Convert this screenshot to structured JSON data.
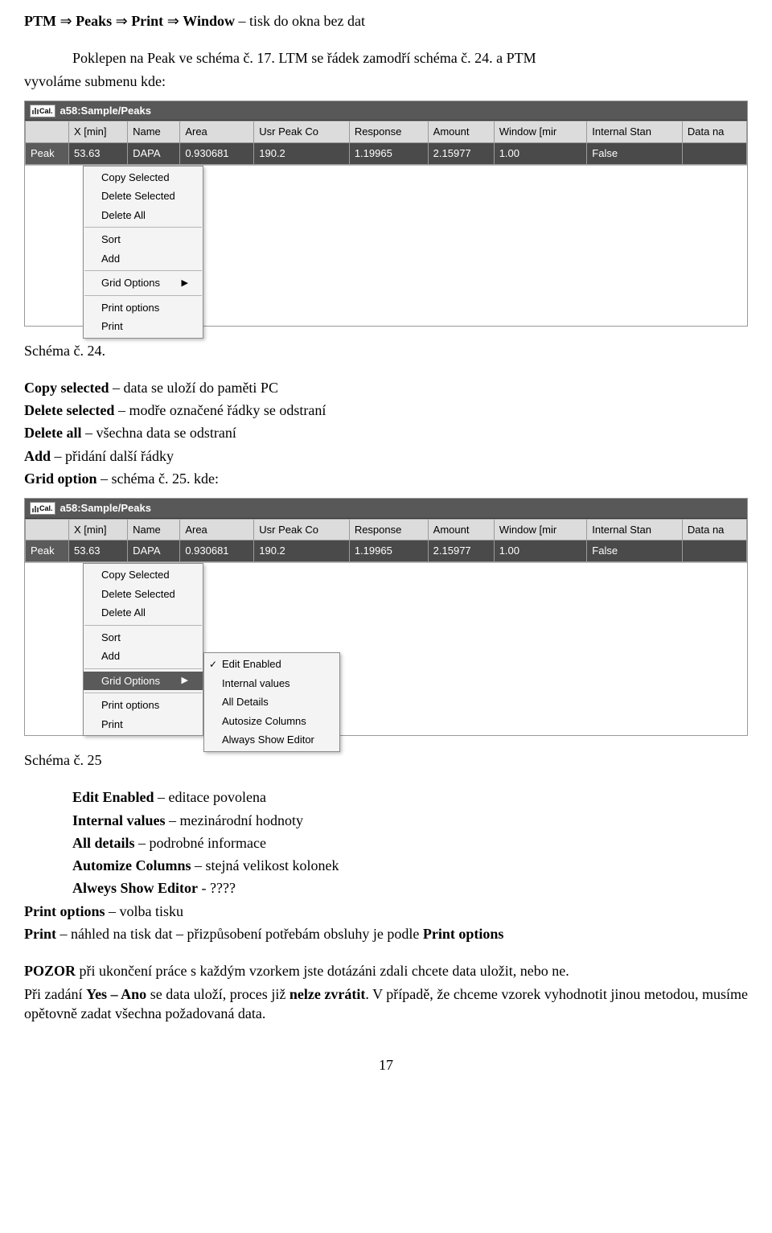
{
  "line1": {
    "b1": "PTM",
    "a1": "⇒",
    "b2": "Peaks",
    "a2": "⇒",
    "b3": "Print",
    "a3": "⇒",
    "b4": "Window",
    "tail": " – tisk do okna bez dat"
  },
  "line2_indent": "Poklepen na Peak ve schéma č. 17. LTM se řádek zamodří schéma č. 24. a PTM",
  "line2b": "vyvoláme submenu kde:",
  "caption1": "Schéma č. 24.",
  "def_block": [
    {
      "b": "Copy selected",
      "t": " – data se uloží do paměti PC"
    },
    {
      "b": "Delete selected",
      "t": " – modře označené řádky se odstraní"
    },
    {
      "b": "Delete all",
      "t": " – všechna data se odstraní"
    },
    {
      "b": "Add",
      "t": " – přidání další řádky"
    },
    {
      "b": "Grid option",
      "t": " – schéma č. 25. kde:"
    }
  ],
  "caption2": "Schéma č. 25",
  "def_block2": [
    {
      "b": "Edit Enabled",
      "t": " – editace povolena"
    },
    {
      "b": "Internal values",
      "t": " – mezinárodní hodnoty"
    },
    {
      "b": "All details",
      "t": " – podrobné informace"
    },
    {
      "b": "Automize Columns",
      "t": " – stejná velikost kolonek"
    },
    {
      "b": "Alweys Show Editor",
      "t": " - ????"
    }
  ],
  "line_po": {
    "b": "Print options",
    "t": " – volba tisku"
  },
  "line_print": {
    "b1": "Print",
    "t1": " – náhled na tisk dat – přizpůsobení potřebám obsluhy je podle ",
    "b2": "Print options"
  },
  "warn": {
    "b": "POZOR",
    "t": " při ukončení práce s každým vzorkem jste dotázáni zdali chcete data uložit, nebo ne."
  },
  "warn2a": "Při zadání ",
  "warn2b": "Yes – Ano",
  "warn2c": " se data uloží, proces již ",
  "warn2d": "nelze zvrátit",
  "warn2e": ". V případě, že chceme vzorek vyhodnotit jinou metodou, musíme opětovně zadat všechna požadovaná data.",
  "pagenum": "17",
  "shot": {
    "cal": "Cal.",
    "title": "a58:Sample/Peaks",
    "headers": [
      "",
      "X [min]",
      "Name",
      "Area",
      "Usr Peak Co",
      "Response",
      "Amount",
      "Window [mir",
      "Internal Stan",
      "Data na"
    ],
    "row": [
      "Peak",
      "53.63",
      "DAPA",
      "0.930681",
      "190.2",
      "1.19965",
      "2.15977",
      "1.00",
      "False",
      ""
    ],
    "menu1": [
      "Copy Selected",
      "Delete Selected",
      "Delete All",
      "Sort",
      "Add",
      "Grid Options",
      "Print options",
      "Print"
    ],
    "submenu": [
      "Edit Enabled",
      "Internal values",
      "All Details",
      "Autosize Columns",
      "Always Show Editor"
    ]
  }
}
